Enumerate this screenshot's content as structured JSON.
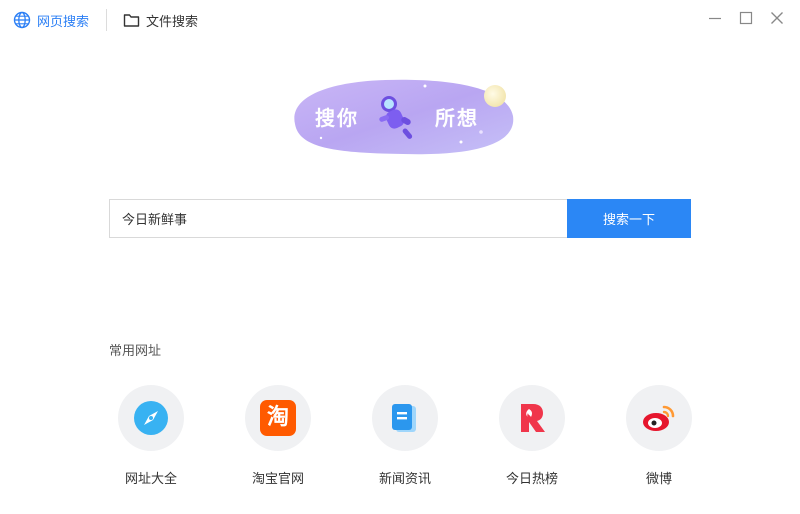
{
  "tabs": [
    {
      "label": "网页搜索",
      "icon": "globe-icon",
      "active": true
    },
    {
      "label": "文件搜索",
      "icon": "folder-icon",
      "active": false
    }
  ],
  "window_controls": {
    "minimize": "minimize-icon",
    "maximize": "maximize-icon",
    "close": "close-icon"
  },
  "hero": {
    "left_text": "搜你",
    "right_text": "所想"
  },
  "search": {
    "value": "今日新鲜事",
    "button_label": "搜索一下"
  },
  "favorites": {
    "title": "常用网址",
    "items": [
      {
        "label": "网址大全",
        "icon": "compass-icon"
      },
      {
        "label": "淘宝官网",
        "icon": "taobao-icon",
        "glyph": "淘"
      },
      {
        "label": "新闻资讯",
        "icon": "news-icon"
      },
      {
        "label": "今日热榜",
        "icon": "hot-list-icon"
      },
      {
        "label": "微博",
        "icon": "weibo-icon"
      }
    ]
  },
  "colors": {
    "accent": "#2b87f5",
    "tab_active": "#2b7ff5",
    "circle_bg": "#f0f1f3"
  }
}
